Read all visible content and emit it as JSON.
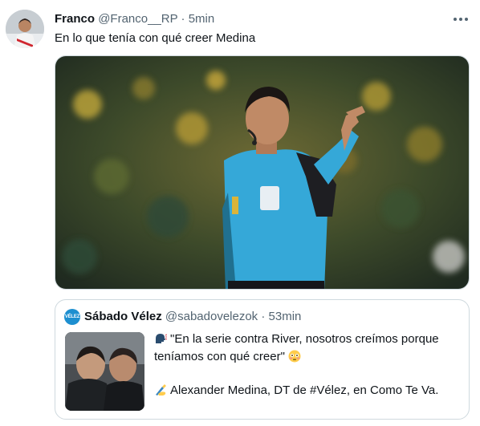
{
  "tweet": {
    "author_name": "Franco",
    "author_handle": "@Franco__RP",
    "separator": "·",
    "time": "5min",
    "text": "En lo que tenía con qué creer Medina",
    "avatar_icon": "user-avatar",
    "more_icon": "more-options-icon"
  },
  "quote": {
    "avatar_text": "VÉLEZ",
    "author_name": "Sábado Vélez",
    "author_handle": "@sabadovelezok",
    "separator": "·",
    "time": "53min",
    "line1": "\"En la serie contra River, nosotros creímos porque",
    "line2": "teníamos con qué creer\"",
    "line3": "Alexander Medina, DT de #Vélez, en Como Te Va.",
    "icons": [
      "speaking-head-emoji",
      "flushed-face-emoji",
      "writing-hand-emoji"
    ]
  },
  "colors": {
    "text": "#0f1419",
    "muted": "#536471",
    "border": "#cfd9de",
    "referee_shirt": "#35a8d8"
  }
}
